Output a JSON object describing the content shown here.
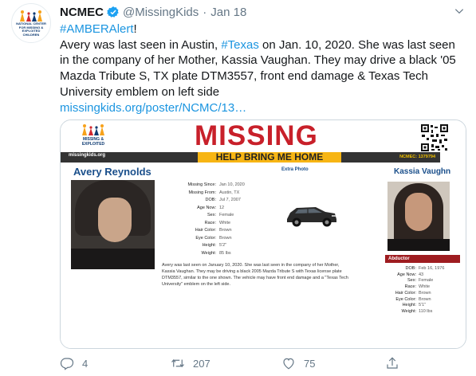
{
  "tweet": {
    "author_name": "NCMEC",
    "handle": "@MissingKids",
    "separator": "·",
    "date": "Jan 18",
    "hashtag_alert": "#AMBERAlert",
    "alert_suffix": "!",
    "body_part1": "Avery was last seen in Austin, ",
    "hashtag_texas": "#Texas",
    "body_part2": " on Jan. 10, 2020. She was last seen in the company of her Mother, Kassia Vaughan. They may drive a black '05 Mazda Tribute S, TX plate DTM3557, front end damage & Texas Tech University emblem on left side",
    "link": "missingkids.org/poster/NCMC/13…"
  },
  "avatar": {
    "logo_text": "NATIONAL CENTER FOR MISSING & EXPLOITED CHILDREN"
  },
  "poster": {
    "logo_text": "MISSING & EXPLOITED",
    "title": "MISSING",
    "banner_site": "missingkids.org",
    "banner_text": "HELP BRING ME HOME",
    "case_number": "NCMEC: 1379794",
    "child_name": "Avery Reynolds",
    "extra_photo_label": "Extra Photo",
    "abductor_name": "Kassia Vaughn",
    "child_details": [
      {
        "label": "Missing Since:",
        "value": "Jan 10, 2020"
      },
      {
        "label": "Missing From:",
        "value": "Austin, TX"
      },
      {
        "label": "DOB:",
        "value": "Jul 7, 2007"
      },
      {
        "label": "Age Now:",
        "value": "12"
      },
      {
        "label": "Sex:",
        "value": "Female"
      },
      {
        "label": "Race:",
        "value": "White"
      },
      {
        "label": "Hair Color:",
        "value": "Brown"
      },
      {
        "label": "Eye Color:",
        "value": "Brown"
      },
      {
        "label": "Height:",
        "value": "5'2\""
      },
      {
        "label": "Weight:",
        "value": "85 lbs"
      }
    ],
    "description": "Avery was last seen on January 10, 2020. She was last seen in the company of her Mother, Kassia Vaughan. They may be driving a black 2005 Mazda Tribute S with Texas license plate DTM3557, similar to the one shown. The vehicle may have front end damage and a \"Texas Tech University\" emblem on the left side.",
    "abductor_label": "Abductor",
    "abductor_details": [
      {
        "label": "DOB:",
        "value": "Feb 16, 1976"
      },
      {
        "label": "Age Now:",
        "value": "43"
      },
      {
        "label": "Sex:",
        "value": "Female"
      },
      {
        "label": "Race:",
        "value": "White"
      },
      {
        "label": "Hair Color:",
        "value": "Brown"
      },
      {
        "label": "Eye Color:",
        "value": "Brown"
      },
      {
        "label": "Height:",
        "value": "5'1\""
      },
      {
        "label": "Weight:",
        "value": "110 lbs"
      }
    ]
  },
  "actions": {
    "reply_count": "4",
    "retweet_count": "207",
    "like_count": "75"
  },
  "colors": {
    "link": "#1b95e0",
    "verified": "#1da1f2",
    "missing_red": "#c8202a",
    "banner_yellow": "#f7b514",
    "poster_blue": "#1a4f8b",
    "abductor_red": "#9e1c20"
  },
  "icons": [
    "verified-badge-icon",
    "caret-down-icon",
    "reply-icon",
    "retweet-icon",
    "like-icon",
    "share-icon",
    "qr-code-icon",
    "car-image",
    "family-logo-icon"
  ]
}
